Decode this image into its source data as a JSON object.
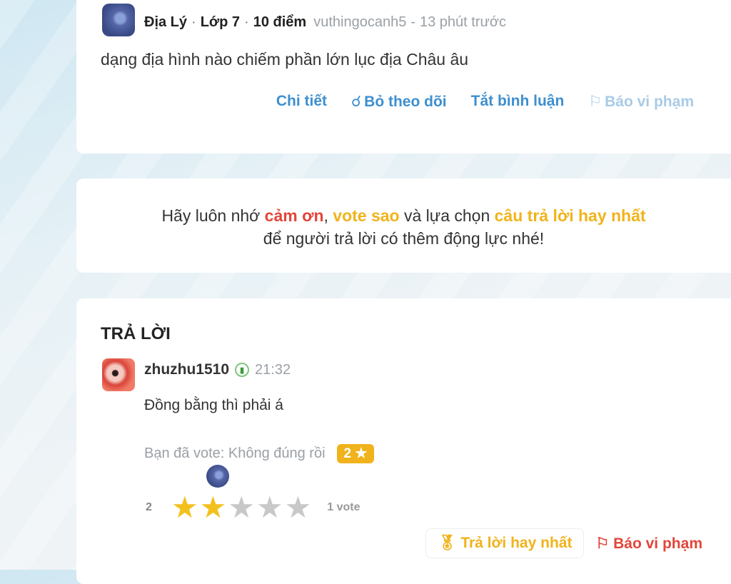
{
  "question": {
    "subject": "Địa Lý",
    "grade": "Lớp 7",
    "points": "10 điểm",
    "author": "vuthingocanh5",
    "time": "13 phút trước",
    "text": "dạng địa hình nào chiếm phần lớn lục địa Châu âu",
    "actions": {
      "detail": "Chi tiết",
      "unfollow": "Bỏ theo dõi",
      "disable_comments": "Tắt bình luận",
      "report": "Báo vi phạm"
    }
  },
  "reminder": {
    "prefix": "Hãy luôn nhớ",
    "thanks": "cảm ơn",
    "comma": ",",
    "vote": "vote sao",
    "middle": "và lựa chọn",
    "best": "câu trả lời hay nhất",
    "line2": "để người trả lời có thêm động lực nhé!"
  },
  "answer": {
    "heading": "TRẢ LỜI",
    "username": "zhuzhu1510",
    "time": "21:32",
    "text": "Đồng bằng thì phải á",
    "voted_text": "Bạn đã vote: Không đúng rồi",
    "vote_badge": "2 ★",
    "rating_value": "2",
    "stars_filled": 2,
    "stars_total": 5,
    "vote_count": "1 vote",
    "best_button": "Trả lời hay nhất",
    "report_button": "Báo vi phạm"
  },
  "colors": {
    "link_blue": "#3d8fcf",
    "accent_red": "#e2463a",
    "accent_yellow": "#f0b31b"
  }
}
